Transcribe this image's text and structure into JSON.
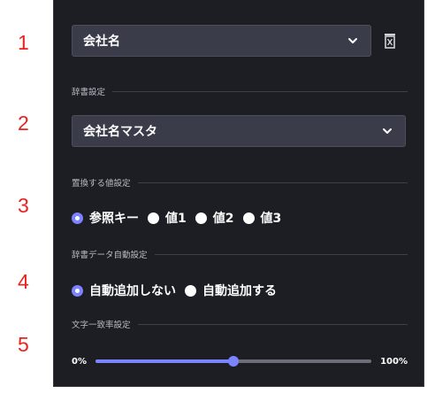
{
  "steps": [
    "1",
    "2",
    "3",
    "4",
    "5"
  ],
  "field_select": {
    "value": "会社名",
    "chevron_icon": "chevron-down-icon"
  },
  "delete_icon": "trash-icon",
  "dictionary": {
    "section_label": "辞書設定",
    "select_value": "会社名マスタ"
  },
  "replace_value": {
    "section_label": "置換する値設定",
    "options": [
      "参照キー",
      "値1",
      "値2",
      "値3"
    ],
    "selected": "参照キー"
  },
  "auto_add": {
    "section_label": "辞書データ自動設定",
    "options": [
      "自動追加しない",
      "自動追加する"
    ],
    "selected": "自動追加しない"
  },
  "match_rate": {
    "section_label": "文字一致率設定",
    "min_label": "0%",
    "max_label": "100%",
    "value_percent": 50
  },
  "colors": {
    "accent": "#7b83ff",
    "panel": "#1d1e24",
    "step_number": "#e8231f"
  }
}
